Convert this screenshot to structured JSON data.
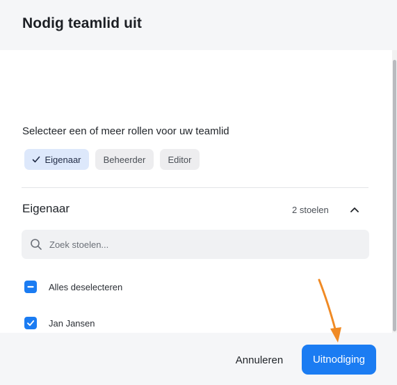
{
  "dialog": {
    "title": "Nodig teamlid uit"
  },
  "roles": {
    "prompt": "Selecteer een of meer rollen voor uw teamlid",
    "options": [
      {
        "label": "Eigenaar",
        "selected": true
      },
      {
        "label": "Beheerder",
        "selected": false
      },
      {
        "label": "Editor",
        "selected": false
      }
    ]
  },
  "section": {
    "title": "Eigenaar",
    "seat_count": "2 stoelen",
    "expanded": true
  },
  "search": {
    "placeholder": "Zoek stoelen...",
    "value": ""
  },
  "seats": {
    "select_all_label": "Alles deselecteren",
    "select_all_state": "indeterminate",
    "items": [
      {
        "label": "Jan Jansen",
        "checked": true
      }
    ]
  },
  "footer": {
    "cancel_label": "Annuleren",
    "invite_label": "Uitnodiging"
  },
  "colors": {
    "accent": "#1b7cf2",
    "chip_selected_bg": "#dde8fb",
    "header_bg": "#f5f6f8",
    "annotation_arrow": "#f08a24"
  },
  "icons": {
    "chip_check": "check-icon",
    "collapse": "chevron-up-icon",
    "search": "search-icon",
    "select_all": "minus-icon",
    "seat_check": "check-icon"
  }
}
